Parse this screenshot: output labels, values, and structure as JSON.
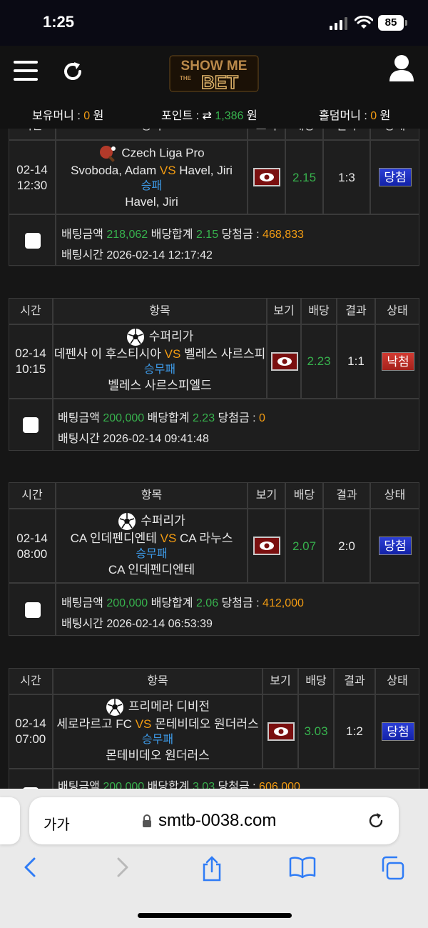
{
  "status_bar": {
    "time": "1:25",
    "battery": "85"
  },
  "header": {
    "logo_text": "SHOW ME THE BET",
    "balances": {
      "money_label": "보유머니 : ",
      "money_value": "0",
      "money_unit": " 원",
      "point_label": "포인트 : ",
      "point_value": "1,386",
      "point_unit": " 원",
      "holdem_label": "홀덤머니 : ",
      "holdem_value": "0",
      "holdem_unit": " 원"
    }
  },
  "columns": {
    "time": "시간",
    "item": "항목",
    "view": "보기",
    "odds": "배당",
    "result": "결과",
    "status": "상태"
  },
  "labels": {
    "bet_amount": "배팅금액 ",
    "odds_total": " 배당합계 ",
    "win_amount": " 당첨금 : ",
    "bet_time": "배팅시간 ",
    "vs": "VS"
  },
  "bets": [
    {
      "date": "02-14",
      "time": "12:30",
      "sport_icon": "table-tennis-icon",
      "league": "Czech Liga Pro",
      "home": "Svoboda, Adam",
      "away": "Havel, Jiri",
      "market": "승패",
      "pick": "Havel, Jiri",
      "odds": "2.15",
      "result": "1:3",
      "status": "당첨",
      "bet_amount": "218,062",
      "odds_total": "2.15",
      "win_amount": "468,833",
      "bet_time": "2026-02-14 12:17:42"
    },
    {
      "date": "02-14",
      "time": "10:15",
      "sport_icon": "soccer-ball-icon",
      "league": "수퍼리가",
      "home": "데펜사 이 후스티시아",
      "away": "벨레스 사르스피",
      "market": "승무패",
      "pick": "벨레스 사르스피엘드",
      "odds": "2.23",
      "result": "1:1",
      "status": "낙첨",
      "bet_amount": "200,000",
      "odds_total": "2.23",
      "win_amount": "0",
      "bet_time": "2026-02-14 09:41:48"
    },
    {
      "date": "02-14",
      "time": "08:00",
      "sport_icon": "soccer-ball-icon",
      "league": "수퍼리가",
      "home": "CA 인데펜디엔테",
      "away": "CA 라누스",
      "market": "승무패",
      "pick": "CA 인데펜디엔테",
      "odds": "2.07",
      "result": "2:0",
      "status": "당첨",
      "bet_amount": "200,000",
      "odds_total": "2.06",
      "win_amount": "412,000",
      "bet_time": "2026-02-14 06:53:39"
    },
    {
      "date": "02-14",
      "time": "07:00",
      "sport_icon": "soccer-ball-icon",
      "league": "프리메라 디비전",
      "home": "세로라르고 FC",
      "away": "몬테비데오 원더러스",
      "market": "승무패",
      "pick": "몬테비데오 원더러스",
      "odds": "3.03",
      "result": "1:2",
      "status": "당첨",
      "bet_amount": "200,000",
      "odds_total": "3.03",
      "win_amount": "606,000",
      "bet_time": ""
    }
  ],
  "safari": {
    "aa": "가가",
    "url": "smtb-0038.com"
  }
}
